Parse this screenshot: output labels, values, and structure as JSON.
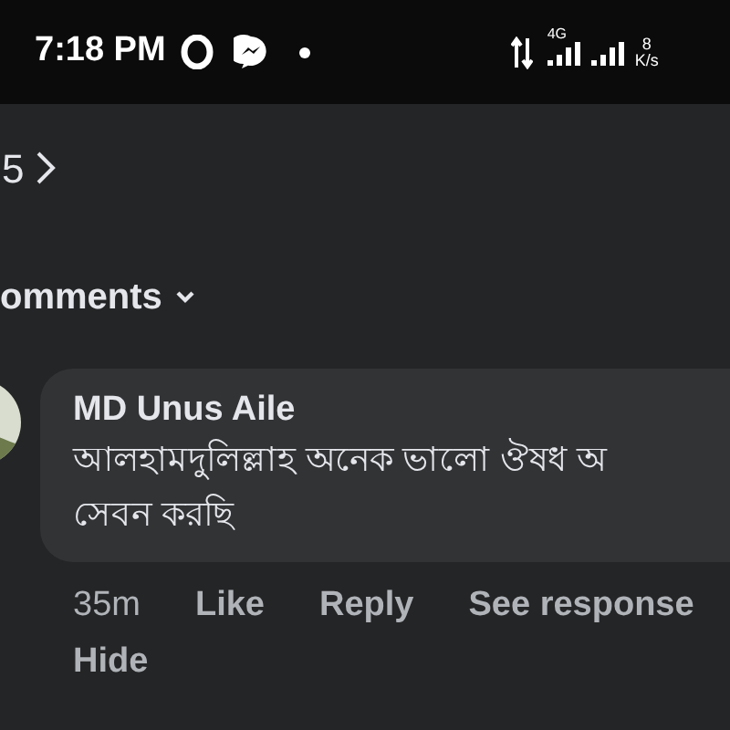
{
  "status_bar": {
    "time": "7:18 PM",
    "network": "4G",
    "speed_value": "8",
    "speed_unit": "K/s"
  },
  "header": {
    "count": "5"
  },
  "comments_filter": {
    "label": "omments"
  },
  "comment": {
    "author": "MD Unus Aile",
    "text_lines": [
      "আলহামদুলিল্লাহ অনেক ভালো ঔষধ অ",
      "সেবন করছি"
    ],
    "time": "35m",
    "actions": [
      "Like",
      "Reply",
      "See response"
    ],
    "hide": "Hide"
  }
}
